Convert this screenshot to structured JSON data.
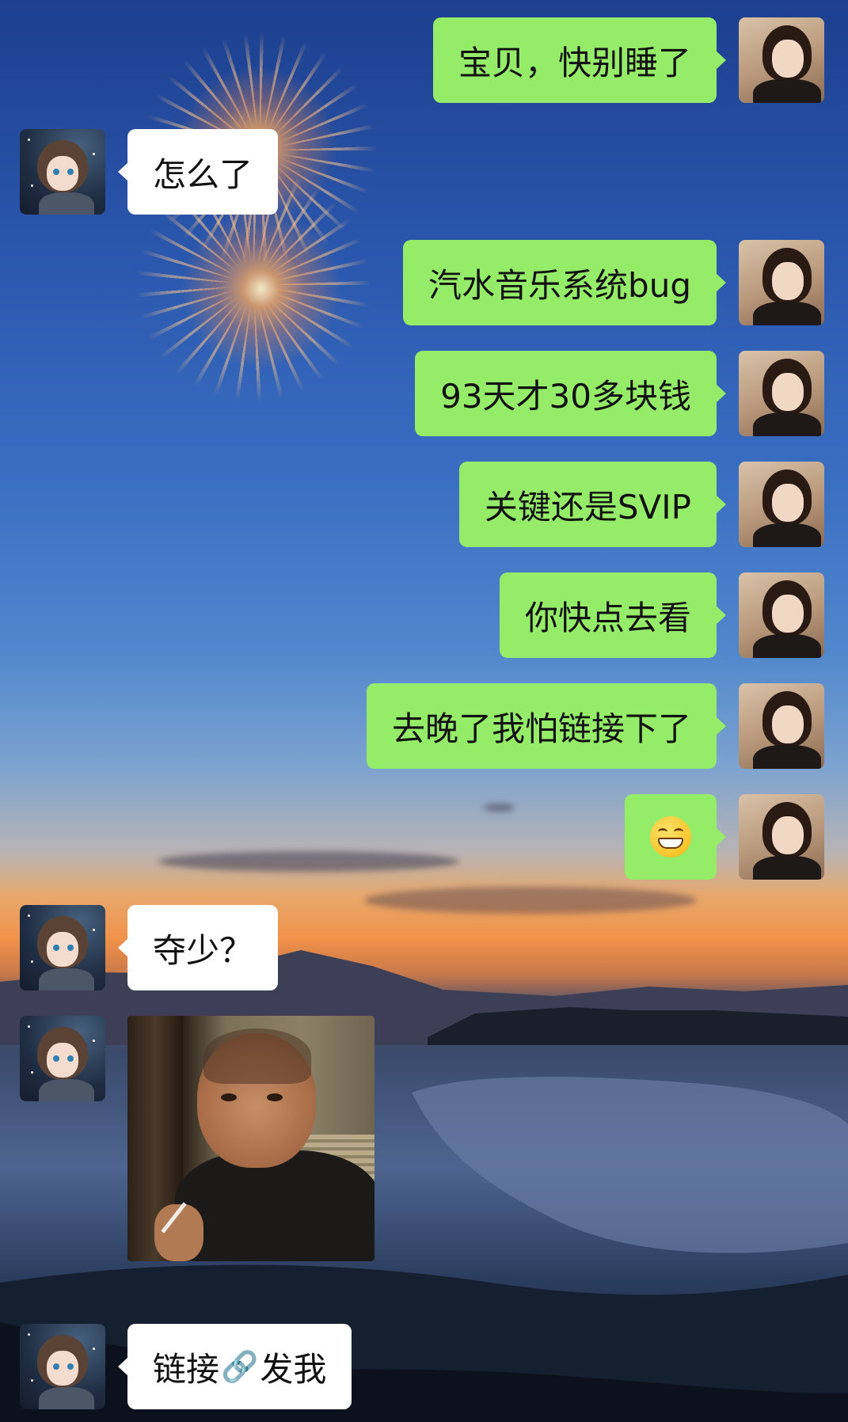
{
  "chat": {
    "messages": [
      {
        "side": "right",
        "sender": "me",
        "text": "宝贝，快别睡了"
      },
      {
        "side": "left",
        "sender": "her",
        "text": "怎么了"
      },
      {
        "side": "right",
        "sender": "me",
        "text": "汽水音乐系统bug"
      },
      {
        "side": "right",
        "sender": "me",
        "text": "93天才30多块钱"
      },
      {
        "side": "right",
        "sender": "me",
        "text": "关键还是SVIP"
      },
      {
        "side": "right",
        "sender": "me",
        "text": "你快点去看"
      },
      {
        "side": "right",
        "sender": "me",
        "text": "去晚了我怕链接下了"
      },
      {
        "side": "right",
        "sender": "me",
        "emoji": "grinning-face-emoji"
      },
      {
        "side": "left",
        "sender": "her",
        "text": "夺少？"
      },
      {
        "side": "left",
        "sender": "her",
        "sticker": "bald-man-peeking-with-cigarette"
      },
      {
        "side": "left",
        "sender": "her",
        "text_before": "链接",
        "icon": "link-icon",
        "text_after": "发我"
      }
    ]
  },
  "colors": {
    "sent_bubble": "#95ec69",
    "received_bubble": "#ffffff",
    "text": "#111111"
  }
}
